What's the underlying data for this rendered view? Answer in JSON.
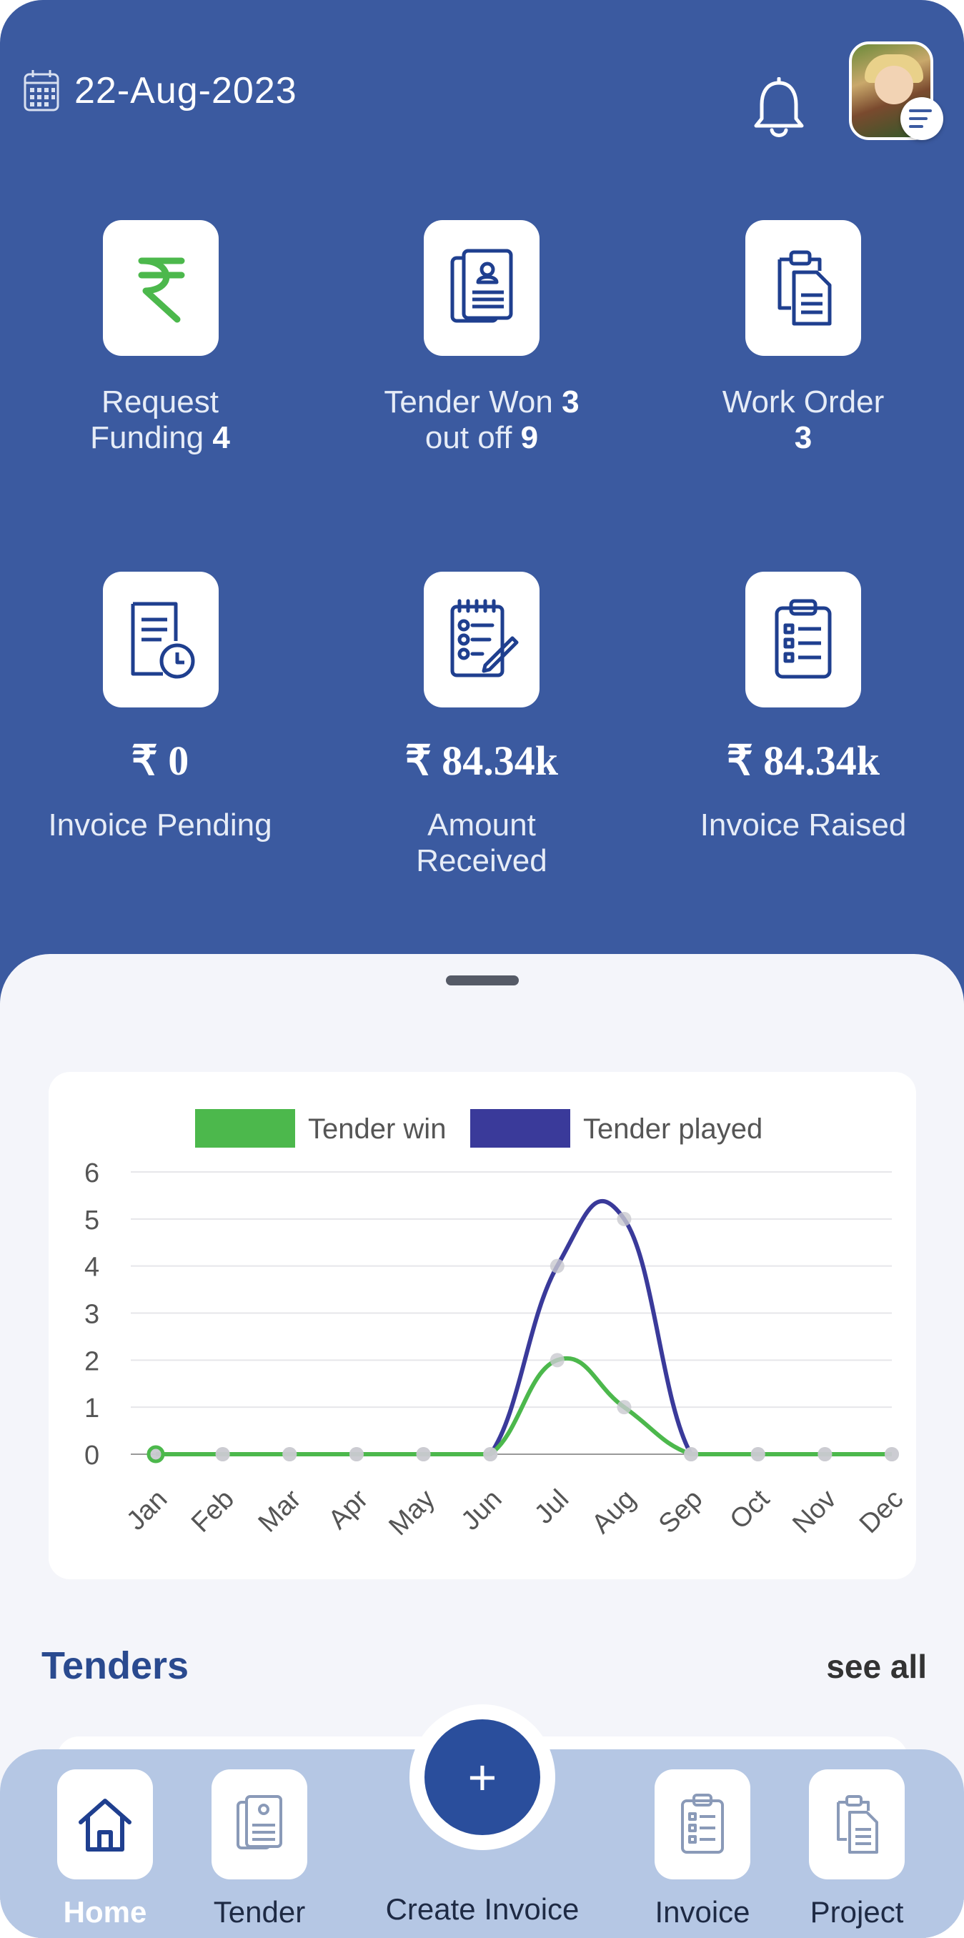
{
  "header": {
    "date": "22-Aug-2023",
    "icons": {
      "calendar": "calendar-icon",
      "bell": "bell-icon",
      "menu": "menu-icon"
    }
  },
  "stats": [
    {
      "label": "Request",
      "label2": "Funding",
      "value": "4",
      "icon": "rupee-icon"
    },
    {
      "label": "Tender Won",
      "value": "3",
      "label2": "out off",
      "value2": "9",
      "icon": "documents-icon"
    },
    {
      "label": "Work Order",
      "value": "3",
      "icon": "clipboard-copy-icon"
    },
    {
      "amount": "₹ 0",
      "label": "Invoice Pending",
      "icon": "document-clock-icon"
    },
    {
      "amount": "₹ 84.34k",
      "label": "Amount",
      "label2": "Received",
      "icon": "checklist-pen-icon"
    },
    {
      "amount": "₹ 84.34k",
      "label": "Invoice Raised",
      "icon": "clipboard-list-icon"
    }
  ],
  "colors": {
    "primary": "#3b5aa0",
    "win": "#4cb84c",
    "played": "#3a3a9a",
    "nav": "#b5c7e4"
  },
  "chart_data": {
    "type": "line",
    "categories": [
      "Jan",
      "Feb",
      "Mar",
      "Apr",
      "May",
      "Jun",
      "Jul",
      "Aug",
      "Sep",
      "Oct",
      "Nov",
      "Dec"
    ],
    "series": [
      {
        "name": "Tender win",
        "values": [
          0,
          0,
          0,
          0,
          0,
          0,
          2,
          1,
          0,
          0,
          0,
          0
        ]
      },
      {
        "name": "Tender played",
        "values": [
          0,
          0,
          0,
          0,
          0,
          0,
          4,
          5,
          0,
          0,
          0,
          0
        ]
      }
    ],
    "ylim": [
      0,
      6
    ],
    "yticks": [
      "0",
      "1",
      "2",
      "3",
      "4",
      "5",
      "6"
    ],
    "legend_position": "top",
    "grid": true
  },
  "section": {
    "title": "Tenders",
    "see_all": "see all"
  },
  "nav": {
    "home": "Home",
    "tender": "Tender",
    "create": "Create Invoice",
    "create_symbol": "+",
    "invoice": "Invoice",
    "project": "Project"
  }
}
